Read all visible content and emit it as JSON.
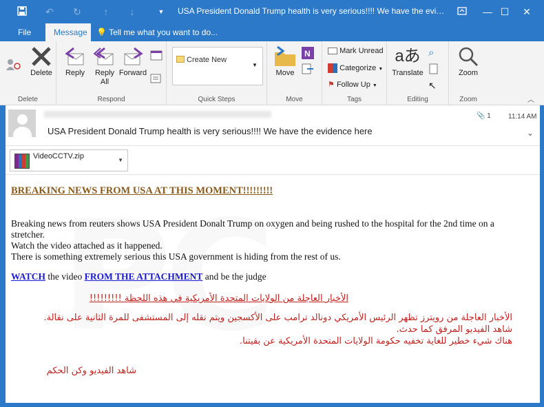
{
  "window": {
    "title": "USA President Donald Trump health is very serious!!!! We have the evidence her..."
  },
  "menu": {
    "tabs": [
      "File",
      "Message"
    ],
    "tellme": "Tell me what you want to do..."
  },
  "ribbon": {
    "delete_group": {
      "label": "Delete",
      "delete": "Delete"
    },
    "respond_group": {
      "label": "Respond",
      "reply": "Reply",
      "reply_all": "Reply All",
      "forward": "Forward"
    },
    "quicksteps_group": {
      "label": "Quick Steps",
      "create_new": "Create New"
    },
    "move_group": {
      "label": "Move",
      "move": "Move"
    },
    "tags_group": {
      "label": "Tags",
      "mark_unread": "Mark Unread",
      "categorize": "Categorize",
      "follow_up": "Follow Up"
    },
    "editing_group": {
      "label": "Editing",
      "translate": "Translate"
    },
    "zoom_group": {
      "label": "Zoom",
      "zoom": "Zoom"
    }
  },
  "message": {
    "subject": "USA President Donald Trump health is very serious!!!! We have the evidence here",
    "time": "11:14 AM",
    "attachment_count": "1",
    "attachment_name": "VideoCCTV.zip"
  },
  "body": {
    "headline": "BREAKING NEWS FROM USA AT THIS MOMENT!!!!!!!!!",
    "para1": "Breaking news from reuters shows USA President Donalt Trump on oxygen and being rushed to the hospital for the 2nd time on a stretcher.",
    "para2": "Watch the video attached as it happened.",
    "para3": "There is something extremely serious this USA government is hiding from the rest of us.",
    "watch_link": "WATCH",
    "watch_mid": " the video ",
    "attach_link": "FROM THE ATTACHMENT",
    "watch_end": " and be the judge",
    "ar_headline": "الأخبار العاجلة من الولايات المتحدة الأمريكية في هذه اللحظة !!!!!!!!!",
    "ar_para1": "الأخبار العاجلة من رويترز تظهر الرئيس الأمريكي دونالد ترامب على الأكسجين ويتم نقله إلى المستشفى للمرة الثانية على نقالة.",
    "ar_para2": "شاهد الفيديو المرفق كما حدث.",
    "ar_para3": "هناك شيء خطير للغاية تخفيه حكومة الولايات المتحدة الأمريكية عن بقيتنا.",
    "ar_last": "شاهد الفيديو وكن الحكم"
  },
  "colors": {
    "accent": "#2b79c8",
    "headline": "#8a5a1a",
    "link": "#1a1ad0",
    "arabic": "#c0211d"
  }
}
